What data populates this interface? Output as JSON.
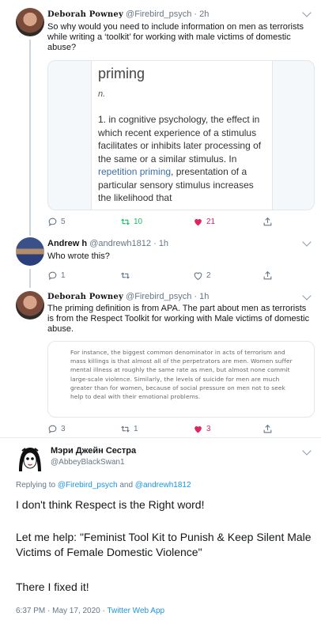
{
  "tweets": [
    {
      "name": "Deborah Powney",
      "handle": "@Firebird_psych",
      "time": "· 2h",
      "text": "So why would you need to include information on men as terrorists while writing a ‘toolkit’ for working with male victims of domestic abuse?",
      "image": {
        "word": "priming",
        "pos": "n.",
        "def_pre": "1. in cognitive psychology, the effect in which recent experience of a stimulus facilitates or inhibits later processing of the same or a similar stimulus. In ",
        "def_link": "repetition priming",
        "def_post": ", presentation of a particular sensory stimulus increases the likelihood that"
      },
      "replies": "5",
      "retweets": "10",
      "likes": "21"
    },
    {
      "name": "Andrew h",
      "handle": "@andrewh1812",
      "time": "· 1h",
      "text": "Who wrote this?",
      "replies": "1",
      "retweets": "",
      "likes": "2"
    },
    {
      "name": "Deborah Powney",
      "handle": "@Firebird_psych",
      "time": "· 1h",
      "text": "The priming definition is from APA.  The part about men as terrorists is from the Respect Toolkit for working with Male victims of domestic abuse.",
      "image_text": "For instance, the biggest common denominator in acts of terrorism and mass killings is that almost all of the perpetrators are men. Women suffer mental illness at roughly the same rate as men, but almost none commit large-scale violence. Similarly, the levels of suicide for men are much greater than for women, because of social pressure on men not to seek help to deal with their emotional problems.",
      "replies": "3",
      "retweets": "1",
      "likes": "3"
    }
  ],
  "focus": {
    "name": "Мэри Джейн Сестра",
    "handle": "@AbbeyBlackSwan1",
    "replying_prefix": "Replying to",
    "replying_user1": "@Firebird_psych",
    "replying_and": "and",
    "replying_user2": "@andrewh1812",
    "line1": "I don't think Respect is the Right word!",
    "line2": "Let me help: \"Feminist Tool Kit to Punish & Keep Silent Male Victims of Female Domestic Violence\"",
    "line3": "There I fixed it!",
    "timestamp": "6:37 PM · May 17, 2020 ·",
    "client": "Twitter Web App"
  },
  "colors": {
    "link": "#1b95e0",
    "retweet_active": "#17bf63",
    "like_active": "#e0245e",
    "muted": "#657786"
  },
  "icons": [
    "reply-icon",
    "retweet-icon",
    "like-icon",
    "share-icon",
    "chevron-down-icon"
  ]
}
